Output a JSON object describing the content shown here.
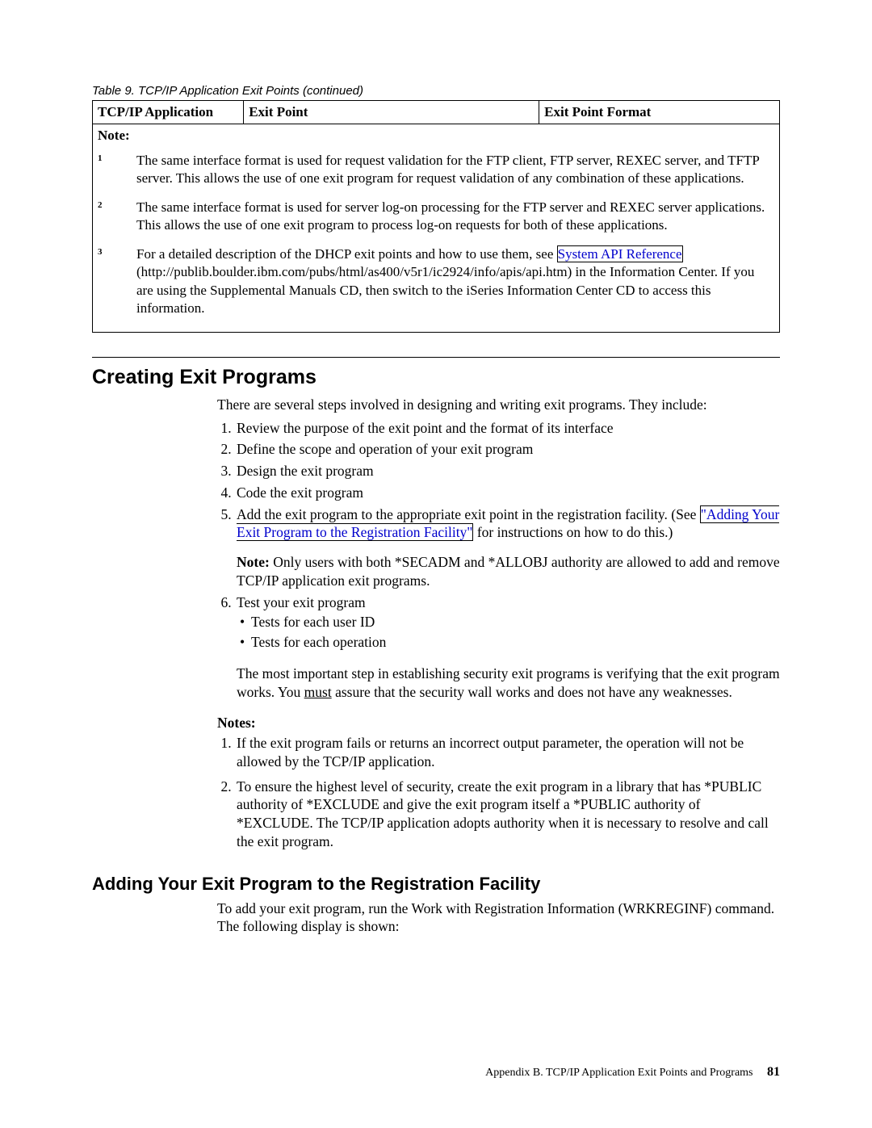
{
  "table": {
    "caption": "Table 9. TCP/IP Application Exit Points  (continued)",
    "headers": [
      "TCP/IP Application",
      "Exit Point",
      "Exit Point Format"
    ],
    "note_label": "Note:",
    "notes": [
      {
        "n": "1",
        "text": "The same interface format is used for request validation for the FTP client, FTP server, REXEC server, and TFTP server. This allows the use of one exit program for request validation of any combination of these applications."
      },
      {
        "n": "2",
        "text": "The same interface format is used for server log-on processing for the FTP server and REXEC server applications. This allows the use of one exit program to process log-on requests for both of these applications."
      },
      {
        "n": "3",
        "pre": "For a detailed description of the DHCP exit points and how to use them, see ",
        "link": "System API Reference",
        "post": " (http://publib.boulder.ibm.com/pubs/html/as400/v5r1/ic2924/info/apis/api.htm) in the Information Center. If you are using the Supplemental Manuals CD, then switch to the iSeries Information Center CD to access this information."
      }
    ]
  },
  "h1": "Creating Exit Programs",
  "intro": "There are several steps involved in designing and writing exit programs. They include:",
  "steps": {
    "s1": "Review the purpose of the exit point and the format of its interface",
    "s2": "Define the scope and operation of your exit program",
    "s3": "Design the exit program",
    "s4": "Code the exit program",
    "s5_pre": "Add the exit program to the appropriate exit point in the registration facility. (See ",
    "s5_link": "\"Adding Your Exit Program to the Registration Facility\"",
    "s5_post": " for instructions on how to do this.)",
    "s5_note_label": "Note:",
    "s5_note": " Only users with both *SECADM and *ALLOBJ authority are allowed to add and remove TCP/IP application exit programs.",
    "s6": "Test your exit program",
    "s6_b1": "Tests for each user ID",
    "s6_b2": "Tests for each operation",
    "s6_para_a": "The most important step in establishing security exit programs is verifying that the exit program works. You ",
    "s6_under": "must",
    "s6_para_b": " assure that the security wall works and does not have any weaknesses."
  },
  "notes_hdr": "Notes:",
  "notes": {
    "n1": "If the exit program fails or returns an incorrect output parameter, the operation will not be allowed by the TCP/IP application.",
    "n2": "To ensure the highest level of security, create the exit program in a library that has *PUBLIC authority of *EXCLUDE and give the exit program itself a *PUBLIC authority of *EXCLUDE. The TCP/IP application adopts authority when it is necessary to resolve and call the exit program."
  },
  "h2": "Adding Your Exit Program to the Registration Facility",
  "h2_body": "To add your exit program, run the Work with Registration Information (WRKREGINF) command. The following display is shown:",
  "footer": {
    "text": "Appendix B. TCP/IP Application Exit Points and Programs",
    "page": "81"
  }
}
